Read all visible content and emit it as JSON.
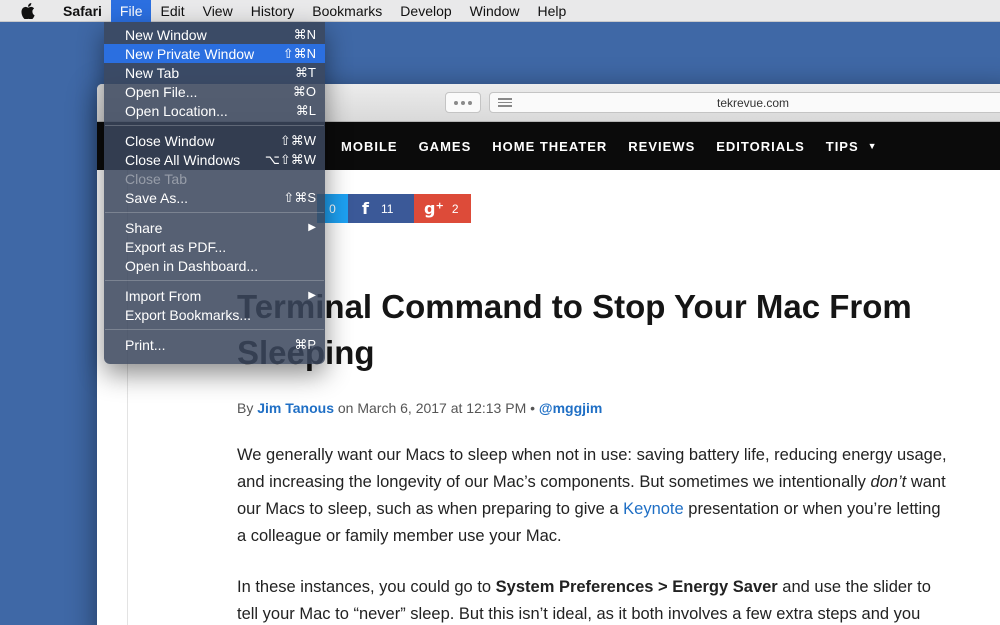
{
  "menubar": {
    "apple_icon": "apple-icon",
    "app": "Safari",
    "items": [
      "File",
      "Edit",
      "View",
      "History",
      "Bookmarks",
      "Develop",
      "Window",
      "Help"
    ]
  },
  "file_menu": {
    "groups": [
      [
        {
          "label": "New Window",
          "shortcut": "⌘N"
        },
        {
          "label": "New Private Window",
          "shortcut": "⇧⌘N"
        },
        {
          "label": "New Tab",
          "shortcut": "⌘T"
        },
        {
          "label": "Open File...",
          "shortcut": "⌘O"
        },
        {
          "label": "Open Location...",
          "shortcut": "⌘L"
        }
      ],
      [
        {
          "label": "Close Window",
          "shortcut": "⇧⌘W"
        },
        {
          "label": "Close All Windows",
          "shortcut": "⌥⇧⌘W"
        },
        {
          "label": "Close Tab",
          "shortcut": ""
        },
        {
          "label": "Save As...",
          "shortcut": "⇧⌘S"
        }
      ],
      [
        {
          "label": "Share",
          "shortcut": "▶"
        },
        {
          "label": "Export as PDF...",
          "shortcut": ""
        },
        {
          "label": "Open in Dashboard...",
          "shortcut": ""
        }
      ],
      [
        {
          "label": "Import From",
          "shortcut": "▶"
        },
        {
          "label": "Export Bookmarks...",
          "shortcut": ""
        }
      ],
      [
        {
          "label": "Print...",
          "shortcut": "⌘P"
        }
      ]
    ]
  },
  "browser": {
    "address": "tekrevue.com"
  },
  "site_nav": [
    "MOBILE",
    "GAMES",
    "HOME THEATER",
    "REVIEWS",
    "EDITORIALS",
    "TIPS"
  ],
  "share": {
    "twitter_count": "0",
    "facebook_count": "11",
    "gplus_count": "2",
    "facebook_glyph": "f",
    "gplus_glyph": "g⁺"
  },
  "article": {
    "title": "Terminal Command to Stop Your Mac From Sleeping",
    "byline_prefix": "By ",
    "author": "Jim Tanous",
    "date": " on March 6, 2017 at 12:13 PM • ",
    "handle": "@mggjim",
    "p1_a": "We generally want our Macs to sleep when not in use: saving battery life, reducing energy usage, and increasing the longevity of our Mac’s components. But sometimes we intentionally ",
    "p1_em": "don’t",
    "p1_b": " want our Macs to sleep, such as when preparing to give a ",
    "p1_link": "Keynote",
    "p1_c": " presentation or when you’re letting a colleague or family member use your Mac.",
    "p2_a": "In these instances, you could go to ",
    "p2_strong": "System Preferences > Energy Saver",
    "p2_b": " and use the slider to tell your Mac to “never” sleep. But this isn’t ideal, as it both involves a few extra steps and you"
  }
}
